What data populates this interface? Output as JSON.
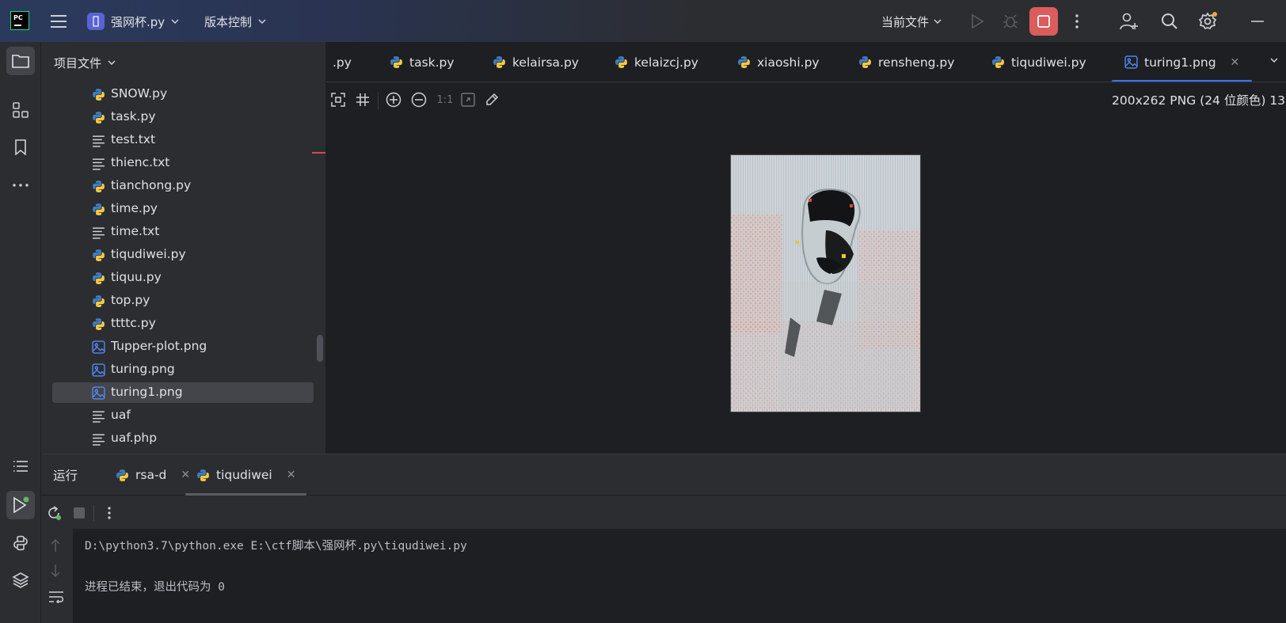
{
  "titlebar": {
    "project_name": "强网杯.py",
    "project_badge": "",
    "vcs_label": "版本控制",
    "run_config": "当前文件"
  },
  "project_panel": {
    "title": "项目文件",
    "files": [
      {
        "name": "SNOW.py",
        "type": "python"
      },
      {
        "name": "task.py",
        "type": "python"
      },
      {
        "name": "test.txt",
        "type": "text"
      },
      {
        "name": "thienc.txt",
        "type": "text"
      },
      {
        "name": "tianchong.py",
        "type": "python"
      },
      {
        "name": "time.py",
        "type": "python"
      },
      {
        "name": "time.txt",
        "type": "text"
      },
      {
        "name": "tiqudiwei.py",
        "type": "python"
      },
      {
        "name": "tiquu.py",
        "type": "python"
      },
      {
        "name": "top.py",
        "type": "python"
      },
      {
        "name": "ttttc.py",
        "type": "python"
      },
      {
        "name": "Tupper-plot.png",
        "type": "image"
      },
      {
        "name": "turing.png",
        "type": "image"
      },
      {
        "name": "turing1.png",
        "type": "image",
        "selected": true
      },
      {
        "name": "uaf",
        "type": "text"
      },
      {
        "name": "uaf.php",
        "type": "text"
      }
    ]
  },
  "editor_tabs": [
    {
      "label": ".py",
      "type": "none"
    },
    {
      "label": "task.py",
      "type": "python"
    },
    {
      "label": "kelairsa.py",
      "type": "python"
    },
    {
      "label": "kelaizcj.py",
      "type": "python"
    },
    {
      "label": "xiaoshi.py",
      "type": "python"
    },
    {
      "label": "rensheng.py",
      "type": "python"
    },
    {
      "label": "tiqudiwei.py",
      "type": "python"
    },
    {
      "label": "turing1.png",
      "type": "image",
      "active": true
    }
  ],
  "image_viewer": {
    "actual_size_label": "1:1",
    "info": "200x262 PNG (24 位颜色) 13"
  },
  "run_panel": {
    "title": "运行",
    "tabs": [
      {
        "label": "rsa-d"
      },
      {
        "label": "tiqudiwei",
        "active": true
      }
    ],
    "console": [
      "D:\\python3.7\\python.exe E:\\ctf脚本\\强网杯.py\\tiqudiwei.py",
      "",
      "进程已结束，退出代码为 0"
    ]
  },
  "colors": {
    "accent": "#3574f0",
    "stop_button": "#db5c5c",
    "python_blue": "#3f7dc1",
    "python_yellow": "#f5c945"
  }
}
